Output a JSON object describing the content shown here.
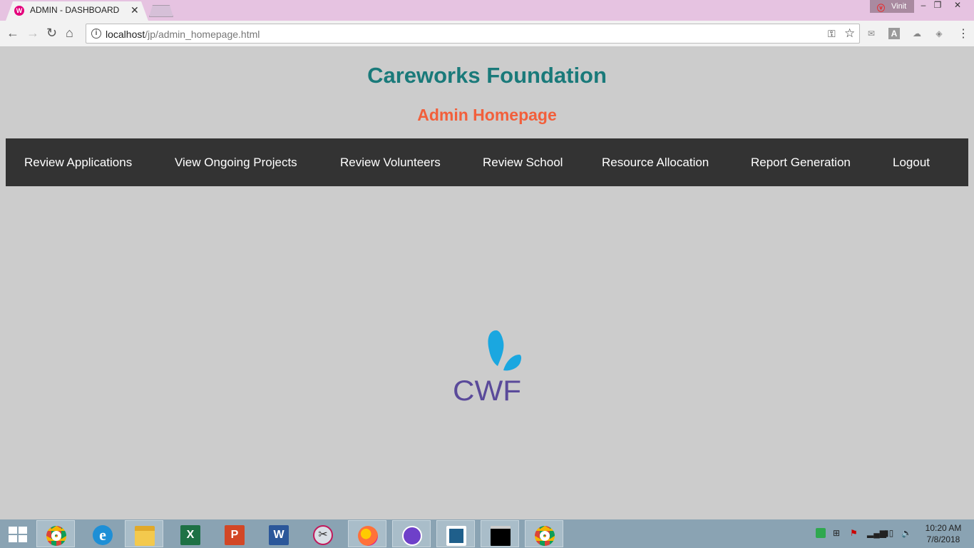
{
  "browser": {
    "tab_title": "ADMIN - DASHBOARD",
    "favicon_text": "W",
    "profile_name": "Vinit",
    "url_host": "localhost",
    "url_path": "/jp/admin_homepage.html",
    "extensions": [
      "envelope-icon",
      "A",
      "cloud-icon",
      "shield-icon"
    ]
  },
  "page": {
    "title": "Careworks Foundation",
    "subtitle": "Admin Homepage",
    "nav": [
      {
        "label": "Review Applications"
      },
      {
        "label": "View Ongoing Projects"
      },
      {
        "label": "Review Volunteers"
      },
      {
        "label": "Review School"
      },
      {
        "label": "Resource Allocation"
      },
      {
        "label": "Report Generation"
      },
      {
        "label": "Logout"
      }
    ],
    "logo_text": "CWF",
    "colors": {
      "title": "#1a7a7a",
      "subtitle": "#f25f3b",
      "navbar_bg": "#333333",
      "logo_text": "#5a4a9a",
      "logo_drop": "#1aa7e0"
    }
  },
  "taskbar": {
    "apps": [
      "chrome-icon",
      "internet-explorer-icon",
      "file-explorer-icon",
      "excel-icon",
      "powerpoint-icon",
      "word-icon",
      "snipping-tool-icon",
      "firefox-icon",
      "github-desktop-icon",
      "brackets-icon",
      "command-prompt-icon",
      "chrome-icon"
    ],
    "time": "10:20 AM",
    "date": "7/8/2018"
  }
}
